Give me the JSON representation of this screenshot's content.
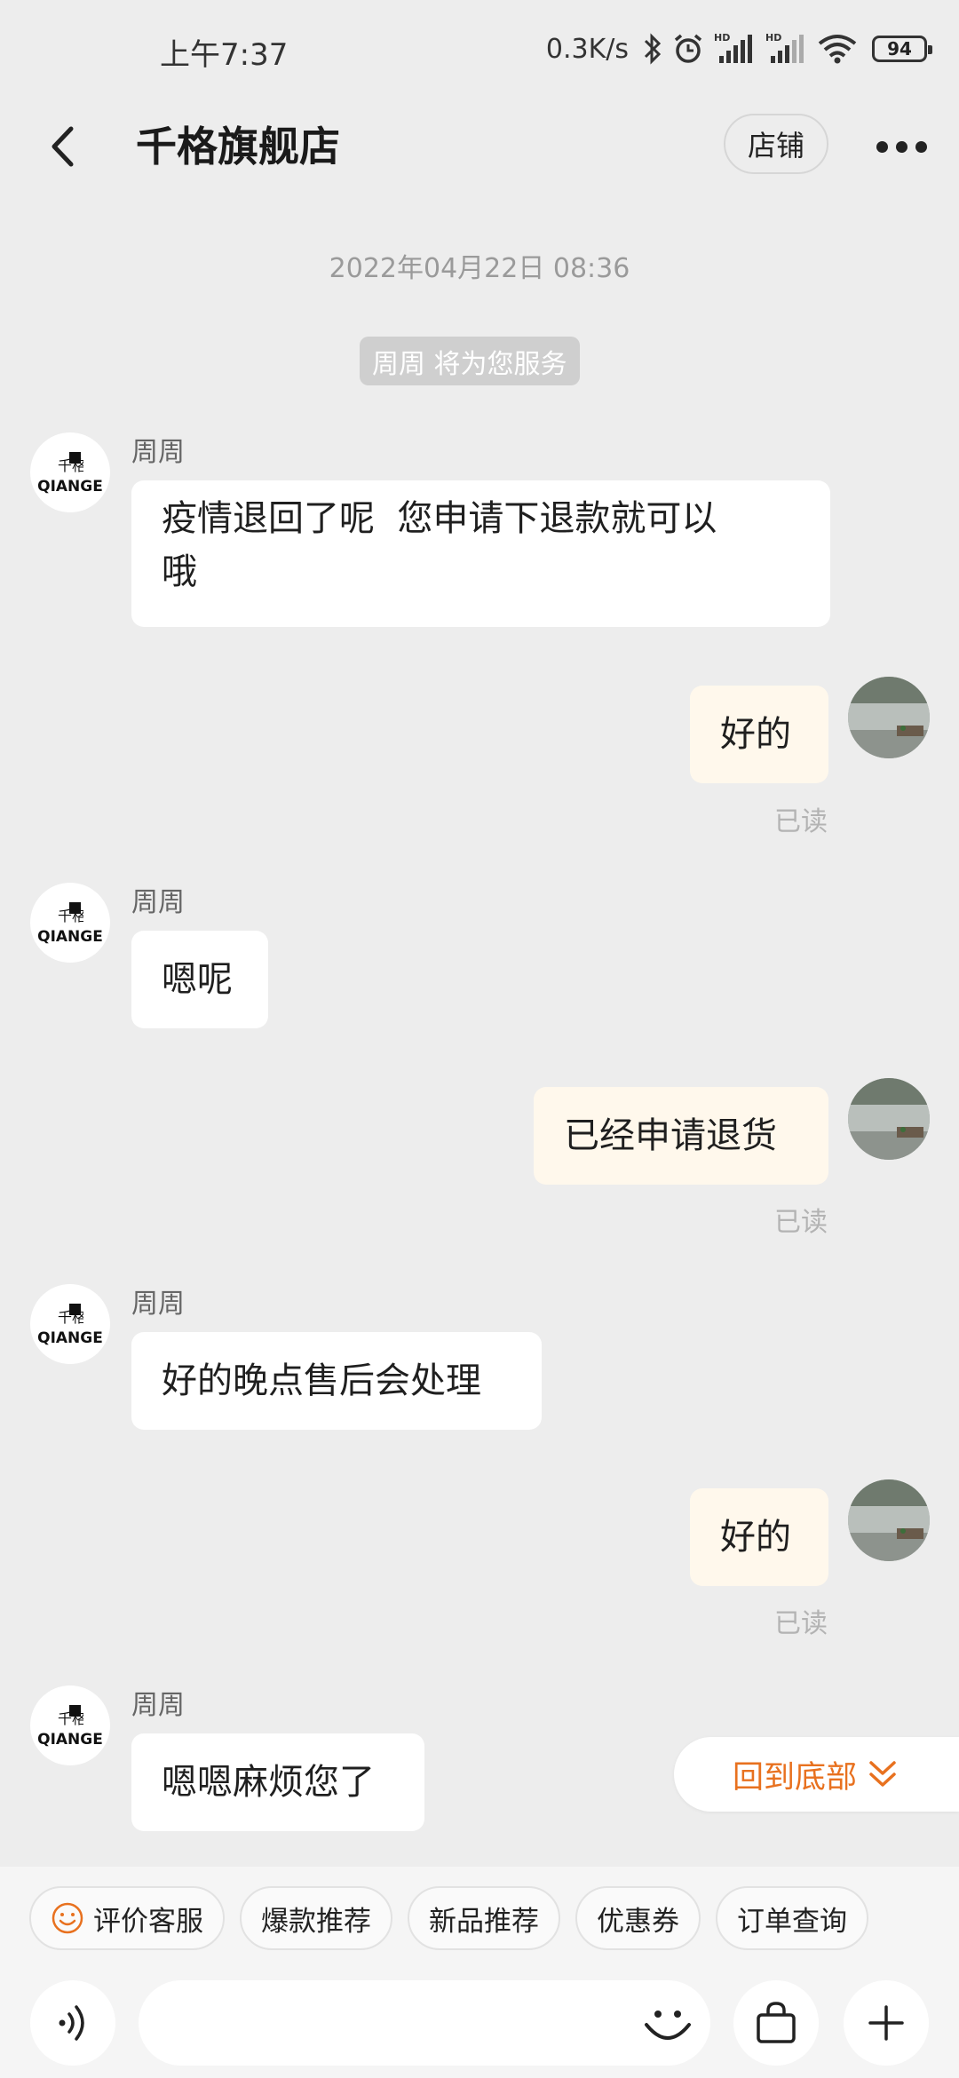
{
  "status_bar": {
    "time": "上午7:37",
    "net_speed": "0.3K/s",
    "battery": "94"
  },
  "header": {
    "title": "千格旗舰店",
    "store_button": "店铺"
  },
  "chat": {
    "timestamp": "2022年04月22日 08:36",
    "service_notice": "周周 将为您服务",
    "store_logo_text": "QIANGE",
    "store_logo_mark": "千格",
    "messages": [
      {
        "sender": "周周",
        "text_line1": "疫情退回了呢  您申请下退款就可以",
        "text_line2": "哦"
      },
      {
        "text": "好的",
        "status": "已读"
      },
      {
        "sender": "周周",
        "text": "嗯呢"
      },
      {
        "text": "已经申请退货",
        "status": "已读"
      },
      {
        "sender": "周周",
        "text": "好的晚点售后会处理"
      },
      {
        "text": "好的",
        "status": "已读"
      },
      {
        "sender": "周周",
        "text": "嗯嗯麻烦您了"
      }
    ],
    "back_to_bottom": "回到底部"
  },
  "quick_actions": [
    {
      "label": "评价客服",
      "icon": "smile-icon"
    },
    {
      "label": "爆款推荐"
    },
    {
      "label": "新品推荐"
    },
    {
      "label": "优惠券"
    },
    {
      "label": "订单查询"
    }
  ],
  "input": {
    "placeholder": ""
  },
  "colors": {
    "background": "#ededed",
    "accent": "#e8711f",
    "user_bubble": "#fff8ec"
  }
}
